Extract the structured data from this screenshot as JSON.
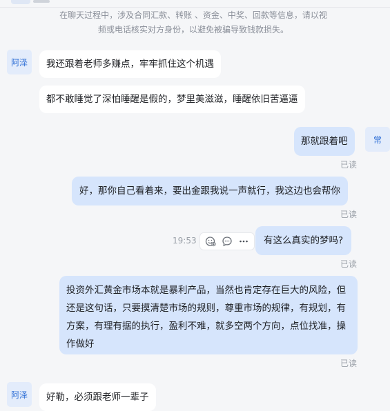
{
  "notice": {
    "line1": "在聊天过程中，涉及合同汇款、转账 、资金、中奖、回款等信息，请以视",
    "line2": "频或电话核实对方身份，以避免被骗导致钱款损失。"
  },
  "contacts": {
    "left_name": "阿泽",
    "right_name": "常"
  },
  "messages": [
    {
      "text": "我还跟着老师多赚点，牢牢抓住这个机遇"
    },
    {
      "text": "都不敢睡觉了深怕睡醒是假的，梦里美滋滋，睡醒依旧苦逼逼"
    },
    {
      "text": "那就跟着吧",
      "status": "已读"
    },
    {
      "text": "好，那你自己看着来，要出金跟我说一声就行，我这边也会帮你",
      "status": "已读"
    },
    {
      "text": "有这么真实的梦吗?",
      "status": "已读",
      "time": "19:53"
    },
    {
      "text": "投资外汇黄金市场本就是暴利产品，当然也肯定存在巨大的风险，但还是这句话，只要摸清楚市场的规则，尊重市场的规律，有规划，有方案，有理有据的执行，盈利不难，就多空两个方向，点位找准，操作做好",
      "status": "已读"
    },
    {
      "text": "好勒，必须跟老师一辈子"
    }
  ],
  "icons": {
    "emoji_reaction": "emoji-add-icon",
    "comment": "comment-icon",
    "more": "more-icon"
  },
  "colors": {
    "background": "#f5f6f8",
    "incoming_bubble": "#ffffff",
    "outgoing_bubble": "#d6e5fc",
    "avatar_bg": "#e3ecfb",
    "avatar_text": "#2f6fd6"
  }
}
